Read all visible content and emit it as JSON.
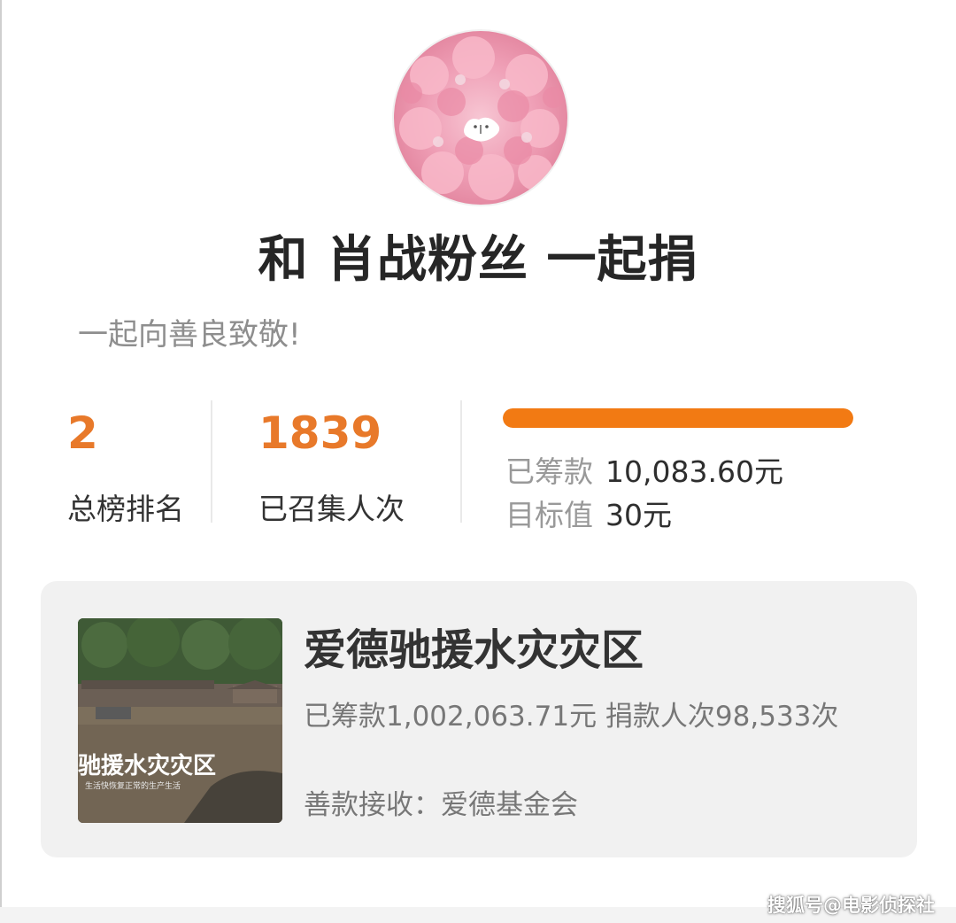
{
  "profile": {
    "avatar_icon": "pink-flowers-cat-avatar",
    "title": "和 肖战粉丝 一起捐",
    "slogan": "一起向善良致敬!"
  },
  "stats": {
    "rank": {
      "value": "2",
      "label": "总榜排名"
    },
    "participants": {
      "value": "1839",
      "label": "已召集人次"
    }
  },
  "fundraising": {
    "progress_fraction": 1.0,
    "raised_label": "已筹款",
    "raised_value": "10,083.60元",
    "target_label": "目标值",
    "target_value": "30元"
  },
  "project": {
    "title": "爱德驰援水灾灾区",
    "summary": "已筹款1,002,063.71元  捐款人次98,533次",
    "recipient": "善款接收：爱德基金会",
    "thumbnail_text": "驰援水灾灾区",
    "thumbnail_subtext": "生活快恢复正常的生产生活"
  },
  "watermark": "搜狐号@电影侦探社",
  "colors": {
    "accent": "#e8792a",
    "progress": "#f27a13"
  }
}
